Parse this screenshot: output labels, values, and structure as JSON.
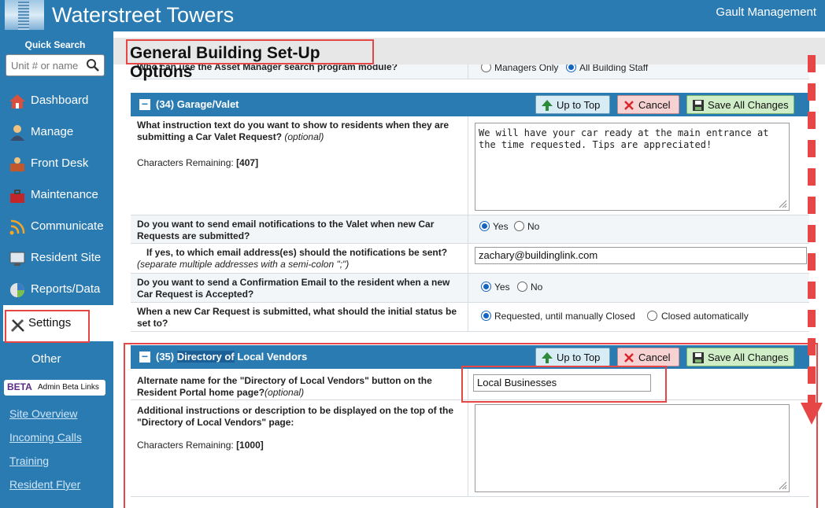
{
  "header": {
    "app_title": "Waterstreet Towers",
    "org_name": "Gault Management"
  },
  "sidebar": {
    "quick_search_label": "Quick Search",
    "quick_search_placeholder": "Unit # or name",
    "items": [
      {
        "label": "Dashboard",
        "icon": "house-icon"
      },
      {
        "label": "Manage",
        "icon": "manager-icon"
      },
      {
        "label": "Front Desk",
        "icon": "front-desk-icon"
      },
      {
        "label": "Maintenance",
        "icon": "toolbox-icon"
      },
      {
        "label": "Communicate",
        "icon": "wifi-icon"
      },
      {
        "label": "Resident Site",
        "icon": "monitor-icon"
      },
      {
        "label": "Reports/Data",
        "icon": "pie-chart-icon"
      },
      {
        "label": "Settings",
        "icon": "tools-icon",
        "active": true
      }
    ],
    "other_label": "Other",
    "beta_tag": "BETA",
    "beta_link": "Admin Beta Links",
    "links": [
      "Site Overview",
      "Incoming Calls",
      "Training",
      "Resident Flyer"
    ]
  },
  "main": {
    "page_title": "General Building Set-Up Options",
    "top_row": {
      "question": "Who can use the Asset Manager search program module?",
      "options": [
        {
          "label": "Managers Only",
          "selected": false
        },
        {
          "label": "All Building Staff",
          "selected": true
        }
      ]
    },
    "buttons": {
      "up": "Up to Top",
      "cancel": "Cancel",
      "save": "Save All Changes"
    },
    "section34": {
      "title": "(34) Garage/Valet",
      "q1": "What instruction text do you want to show to residents when they are submitting a Car Valet Request?",
      "q1_optional": "(optional)",
      "q1_chars_label": "Characters Remaining:",
      "q1_chars_value": "[407]",
      "q1_value": "We will have your car ready at the main entrance at the time requested. Tips are appreciated!",
      "q2": "Do you want to send email notifications to the Valet when new Car Requests are submitted?",
      "q2_options": [
        {
          "label": "Yes",
          "selected": true
        },
        {
          "label": "No",
          "selected": false
        }
      ],
      "q3": "If yes, to which email address(es) should the notifications be sent?",
      "q3_hint": "(separate multiple addresses with a semi-colon \";\")",
      "q3_value": "zachary@buildinglink.com",
      "q4": "Do you want to send a Confirmation Email to the resident when a new Car Request is Accepted?",
      "q4_options": [
        {
          "label": "Yes",
          "selected": true
        },
        {
          "label": "No",
          "selected": false
        }
      ],
      "q5": "When a new Car Request is submitted, what should the initial status be set to?",
      "q5_options": [
        {
          "label": "Requested, until manually Closed",
          "selected": true
        },
        {
          "label": "Closed automatically",
          "selected": false
        }
      ]
    },
    "section35": {
      "title_prefix": "(35) ",
      "title_highlight": "Directory of",
      "title_suffix": " Local Vendors",
      "q1": "Alternate name for the \"Directory of Local Vendors\" button on the Resident Portal home page?",
      "q1_optional": "(optional)",
      "q1_value": "Local Businesses",
      "q2": "Additional instructions or description to be displayed on the top of the \"Directory of Local Vendors\" page:",
      "q2_chars_label": "Characters Remaining:",
      "q2_chars_value": "[1000]",
      "q2_value": ""
    }
  },
  "colors": {
    "brand_blue": "#2b7bb3",
    "annotation_red": "#e64646",
    "radio_blue": "#1565c0"
  }
}
